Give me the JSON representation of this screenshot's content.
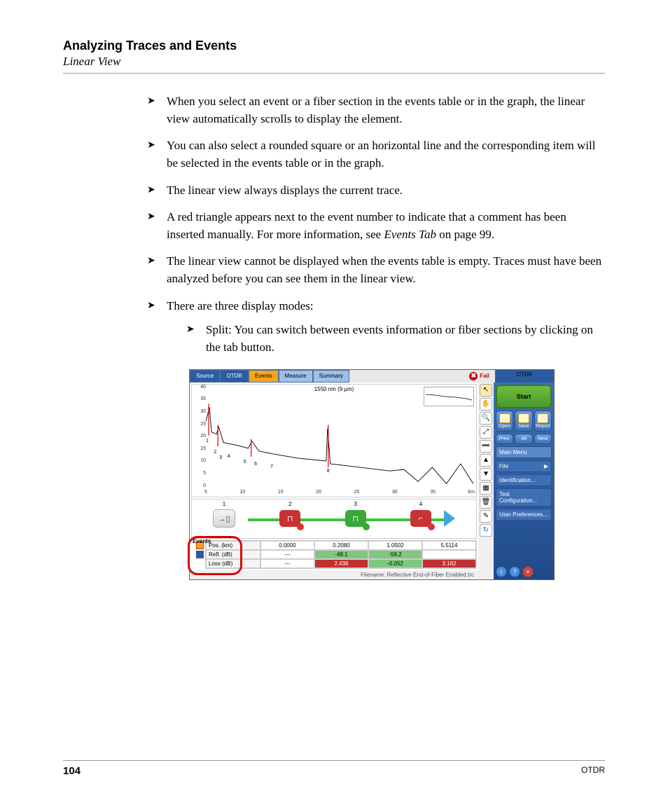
{
  "header": {
    "chapter": "Analyzing Traces and Events",
    "section": "Linear View"
  },
  "bullets": {
    "b1": "When you select an event or a fiber section in the events table or in the graph, the linear view automatically scrolls to display the element.",
    "b2": "You can also select a rounded square or an horizontal line and the corresponding item will be selected in the events table or in the graph.",
    "b3": "The linear view always displays the current trace.",
    "b4a": "A red triangle appears next to the event number to indicate that a comment has been inserted manually. For more information, see ",
    "b4b": "Events Tab",
    "b4c": " on page 99.",
    "b5": "The linear view cannot be displayed when the events table is empty. Traces must have been analyzed before you can see them in the linear view.",
    "b6": "There are three display modes:",
    "b6s1": "Split: You can switch between events information or fiber sections by clicking on the tab button."
  },
  "screenshot": {
    "tabs": {
      "source": "Source",
      "otdr": "OTDR",
      "events": "Events",
      "measure": "Measure",
      "summary": "Summary"
    },
    "fail_label": "Fail",
    "chart": {
      "title": "1550 nm (9 µm)",
      "y": [
        "40",
        "35",
        "30",
        "25",
        "20",
        "15",
        "10",
        "5",
        "0"
      ],
      "x": [
        "5",
        "10",
        "15",
        "20",
        "25",
        "30",
        "35",
        "km"
      ],
      "pts": [
        "1",
        "2",
        "3",
        "4",
        "5",
        "6",
        "7",
        "8"
      ]
    },
    "linear": {
      "n1": "1",
      "n2": "2",
      "n3": "3",
      "n4": "4"
    },
    "events_label": "Events",
    "rows": {
      "pos": {
        "h": "Pos. (km)",
        "c1": "0.0000",
        "c2": "0.2080",
        "c3": "1.0502",
        "c4": "5.5114"
      },
      "refl": {
        "h": "Refl. (dB)",
        "c1": "---",
        "c2": "-48.1",
        "c3": "-59.2",
        "c4": ""
      },
      "loss": {
        "h": "Loss (dB)",
        "c1": "---",
        "c2": "2.436",
        "c3": "-0.052",
        "c4": "3.162"
      }
    },
    "filename": "Filename: Reflective End-of-Fiber Enabled.trc",
    "menu": {
      "title": "OTDR",
      "start": "Start",
      "open": "Open",
      "save": "Save",
      "report": "Report",
      "prev": "Prev.",
      "all": "All",
      "next": "Next",
      "main": "Main Menu",
      "file": "File",
      "ident": "Identification...",
      "testcfg": "Test Configuration...",
      "userpref": "User Preferences..."
    }
  },
  "footer": {
    "page": "104",
    "doc": "OTDR"
  }
}
